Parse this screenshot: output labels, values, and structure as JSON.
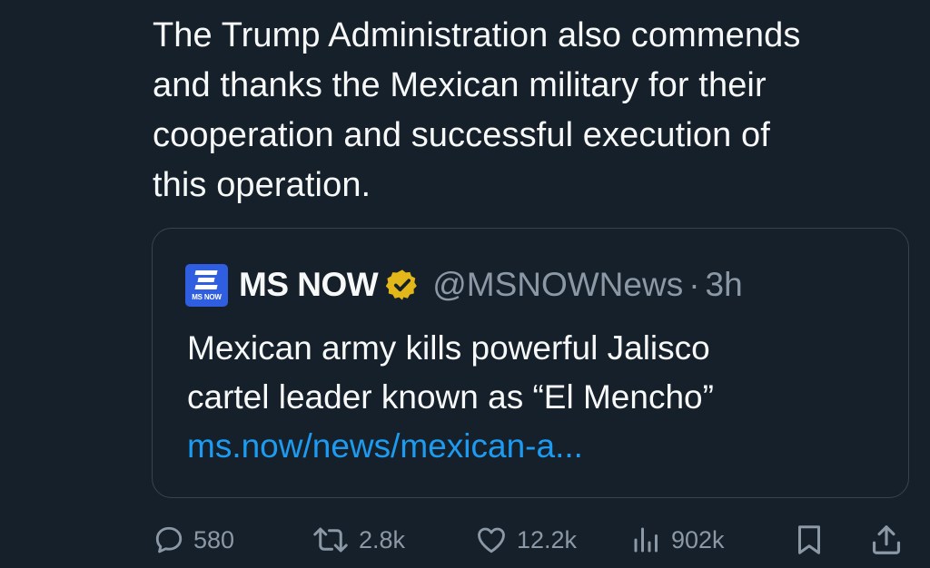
{
  "tweet": {
    "text_lines": [
      "The Trump Administration also commends",
      "and thanks the Mexican military for their",
      "cooperation and successful execution of",
      "this operation."
    ]
  },
  "quote": {
    "avatar_label": "MS NOW",
    "display_name": "MS NOW",
    "verified_icon": "gold-verified-badge-icon",
    "handle": "@MSNOWNews",
    "separator": "·",
    "time": "3h",
    "text_lines": [
      "Mexican army kills powerful Jalisco",
      "cartel leader known as “El Mencho”"
    ],
    "link": "ms.now/news/mexican-a..."
  },
  "actions": {
    "replies": "580",
    "reposts": "2.8k",
    "likes": "12.2k",
    "views": "902k"
  },
  "colors": {
    "background": "#15202b",
    "text": "#f7f9f9",
    "secondary": "#8b98a5",
    "link": "#1d9bf0",
    "border": "#38444d",
    "verified_gold": "#e2b719",
    "avatar_blue": "#2f5fe0"
  }
}
